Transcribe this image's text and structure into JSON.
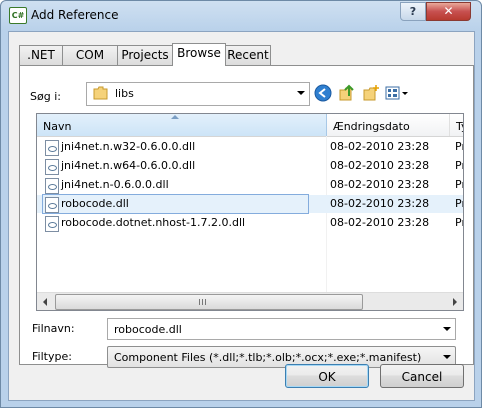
{
  "window": {
    "title": "Add Reference",
    "app_icon_text": "C#",
    "help_label": "?",
    "close_label": "✕"
  },
  "tabs": [
    {
      "label": ".NET"
    },
    {
      "label": "COM"
    },
    {
      "label": "Projects"
    },
    {
      "label": "Browse",
      "active": true
    },
    {
      "label": "Recent"
    }
  ],
  "lookin": {
    "label": "Søg i:",
    "value": "libs"
  },
  "toolbar_icons": [
    "back-icon",
    "up-folder-icon",
    "new-folder-icon",
    "view-menu-icon"
  ],
  "filelist": {
    "columns": [
      "Navn",
      "Ændringsdato",
      "Ty"
    ],
    "sorted_column": "Navn",
    "rows": [
      {
        "name": "jni4net.n.w32-0.6.0.0.dll",
        "date": "08-02-2010 23:28",
        "type": "Pr",
        "selected": false
      },
      {
        "name": "jni4net.n.w64-0.6.0.0.dll",
        "date": "08-02-2010 23:28",
        "type": "Pr",
        "selected": false
      },
      {
        "name": "jni4net.n-0.6.0.0.dll",
        "date": "08-02-2010 23:28",
        "type": "Pr",
        "selected": false
      },
      {
        "name": "robocode.dll",
        "date": "08-02-2010 23:28",
        "type": "Pr",
        "selected": true
      },
      {
        "name": "robocode.dotnet.nhost-1.7.2.0.dll",
        "date": "08-02-2010 23:28",
        "type": "Pr",
        "selected": false
      }
    ]
  },
  "filename": {
    "label": "Filnavn:",
    "value": "robocode.dll"
  },
  "filetype": {
    "label": "Filtype:",
    "value": "Component Files (*.dll;*.tlb;*.olb;*.ocx;*.exe;*.manifest)"
  },
  "buttons": {
    "ok": "OK",
    "cancel": "Cancel"
  },
  "colors": {
    "selection": "#e5f1fb",
    "frame": "#b9d1ea",
    "close": "#c75050"
  }
}
